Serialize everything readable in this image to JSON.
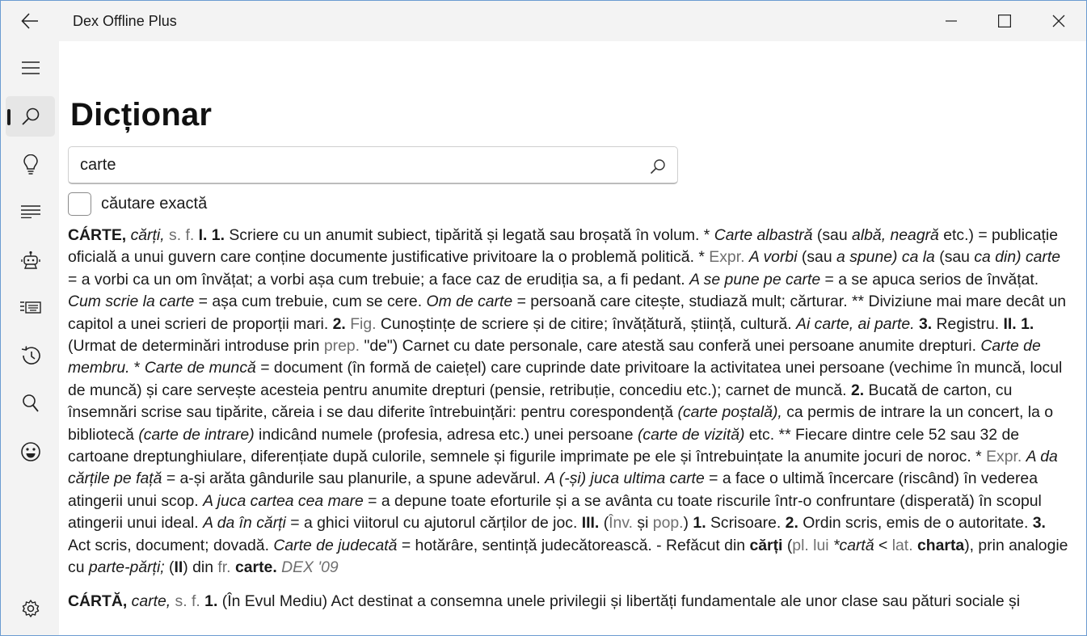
{
  "window": {
    "title": "Dex Offline Plus"
  },
  "titlebar": {
    "back_icon": "arrow-left-icon",
    "minimize_icon": "minimize-icon",
    "maximize_icon": "maximize-icon",
    "close_icon": "close-icon"
  },
  "sidebar": {
    "items": [
      {
        "name": "menu",
        "icon": "hamburger-icon"
      },
      {
        "name": "search",
        "icon": "search-icon",
        "active": true
      },
      {
        "name": "lightbulb",
        "icon": "lightbulb-icon"
      },
      {
        "name": "list",
        "icon": "list-icon"
      },
      {
        "name": "robot",
        "icon": "robot-icon"
      },
      {
        "name": "keyboard",
        "icon": "keyboard-icon"
      },
      {
        "name": "history",
        "icon": "history-icon"
      },
      {
        "name": "lookup",
        "icon": "magnify-icon"
      },
      {
        "name": "emoji",
        "icon": "emoji-icon"
      },
      {
        "name": "settings",
        "icon": "gear-icon"
      }
    ]
  },
  "main": {
    "page_title": "Dicționar",
    "search": {
      "value": "carte",
      "placeholder": ""
    },
    "exact_search": {
      "label": "căutare exactă",
      "checked": false
    }
  },
  "definitions": {
    "entry1": {
      "t01": "CÁRTE,",
      "t02": "cărți,",
      "t03": "s. f.",
      "t04": "I. 1.",
      "t05": "Scriere cu un anumit subiect, tipărită și legată sau broșată în volum. *",
      "t06": "Carte albastră",
      "t07": "(sau",
      "t08": "albă, neagră",
      "t09": "etc.) = publicație oficială a unui guvern care conține documente justificative privitoare la o problemă politică. *",
      "t10": "Expr.",
      "t11": "A vorbi",
      "t12": "(sau",
      "t13": "a spune) ca la",
      "t14": "(sau",
      "t15": "ca din) carte",
      "t16": "= a vorbi ca un om învățat; a vorbi așa cum trebuie; a face caz de erudiția sa, a fi pedant.",
      "t17": "A se pune pe carte",
      "t18": "= a se apuca serios de învățat.",
      "t19": "Cum scrie la carte",
      "t20": "= așa cum trebuie, cum se cere.",
      "t21": "Om de carte",
      "t22": "= persoană care citește, studiază mult; cărturar. ** Diviziune mai mare decât un capitol a unei scrieri de proporții mari.",
      "t23": "2.",
      "t24": "Fig.",
      "t25": "Cunoștințe de scriere și de citire; învățătură, știință, cultură.",
      "t26": "Ai carte, ai parte.",
      "t27": "3.",
      "t28": "Registru.",
      "t29": "II. 1.",
      "t30": "(Urmat de determinări introduse prin",
      "t31": "prep.",
      "t32": "\"de\") Carnet cu date personale, care atestă sau conferă unei persoane anumite drepturi.",
      "t33": "Carte de membru.",
      "t34": "*",
      "t35": "Carte de muncă",
      "t36": "= document (în formă de caiețel) care cuprinde date privitoare la activitatea unei persoane (vechime în muncă, locul de muncă) și care servește acesteia pentru anumite drepturi (pensie, retribuție, concediu etc.); carnet de muncă.",
      "t37": "2.",
      "t38": "Bucată de carton, cu însemnări scrise sau tipărite, căreia i se dau diferite întrebuințări: pentru corespondență",
      "t39": "(carte poștală),",
      "t40": "ca permis de intrare la un concert, la o bibliotecă",
      "t41": "(carte de intrare)",
      "t42": "indicând numele (profesia, adresa etc.) unei persoane",
      "t43": "(carte de vizită)",
      "t44": "etc. ** Fiecare dintre cele 52 sau 32 de cartoane dreptunghiulare, diferențiate după culorile, semnele și figurile imprimate pe ele și întrebuințate la anumite jocuri de noroc. *",
      "t45": "Expr.",
      "t46": "A da cărțile pe față",
      "t47": "= a-și arăta gândurile sau planurile, a spune adevărul.",
      "t48": "A (-și) juca ultima carte",
      "t49": "= a face o ultimă încercare (riscând) în vederea atingerii unui scop.",
      "t50": "A juca cartea cea mare",
      "t51": "= a depune toate eforturile și a se avânta cu toate riscurile într-o confruntare (disperată) în scopul atingerii unui ideal.",
      "t52": "A da în cărți",
      "t53": "= a ghici viitorul cu ajutorul cărților de joc.",
      "t54": "III.",
      "t55": "(",
      "t56": "Înv.",
      "t57": "și",
      "t58": "pop.",
      "t59": ")",
      "t60": "1.",
      "t61": "Scrisoare.",
      "t62": "2.",
      "t63": "Ordin scris, emis de o autoritate.",
      "t64": "3.",
      "t65": "Act scris, document; dovadă.",
      "t66": "Carte de judecată",
      "t67": "= hotărâre, sentință judecătorească. - Refăcut din",
      "t68": "cărți",
      "t69": "(",
      "t70": "pl. lui",
      "t71": "*cartă",
      "t72": "<",
      "t73": "lat.",
      "t74": "charta",
      "t75": "), prin analogie cu",
      "t76": "parte-părți;",
      "t77": "(",
      "t78": "II",
      "t79": ") din",
      "t80": "fr.",
      "t81": "carte.",
      "t82": "DEX '09"
    },
    "entry2": {
      "t01": "CÁRTĂ,",
      "t02": "carte,",
      "t03": "s. f.",
      "t04": "1.",
      "t05": "(În Evul Mediu) Act destinat a consemna unele privilegii și libertăți fundamentale ale unor clase sau pături sociale și"
    }
  }
}
